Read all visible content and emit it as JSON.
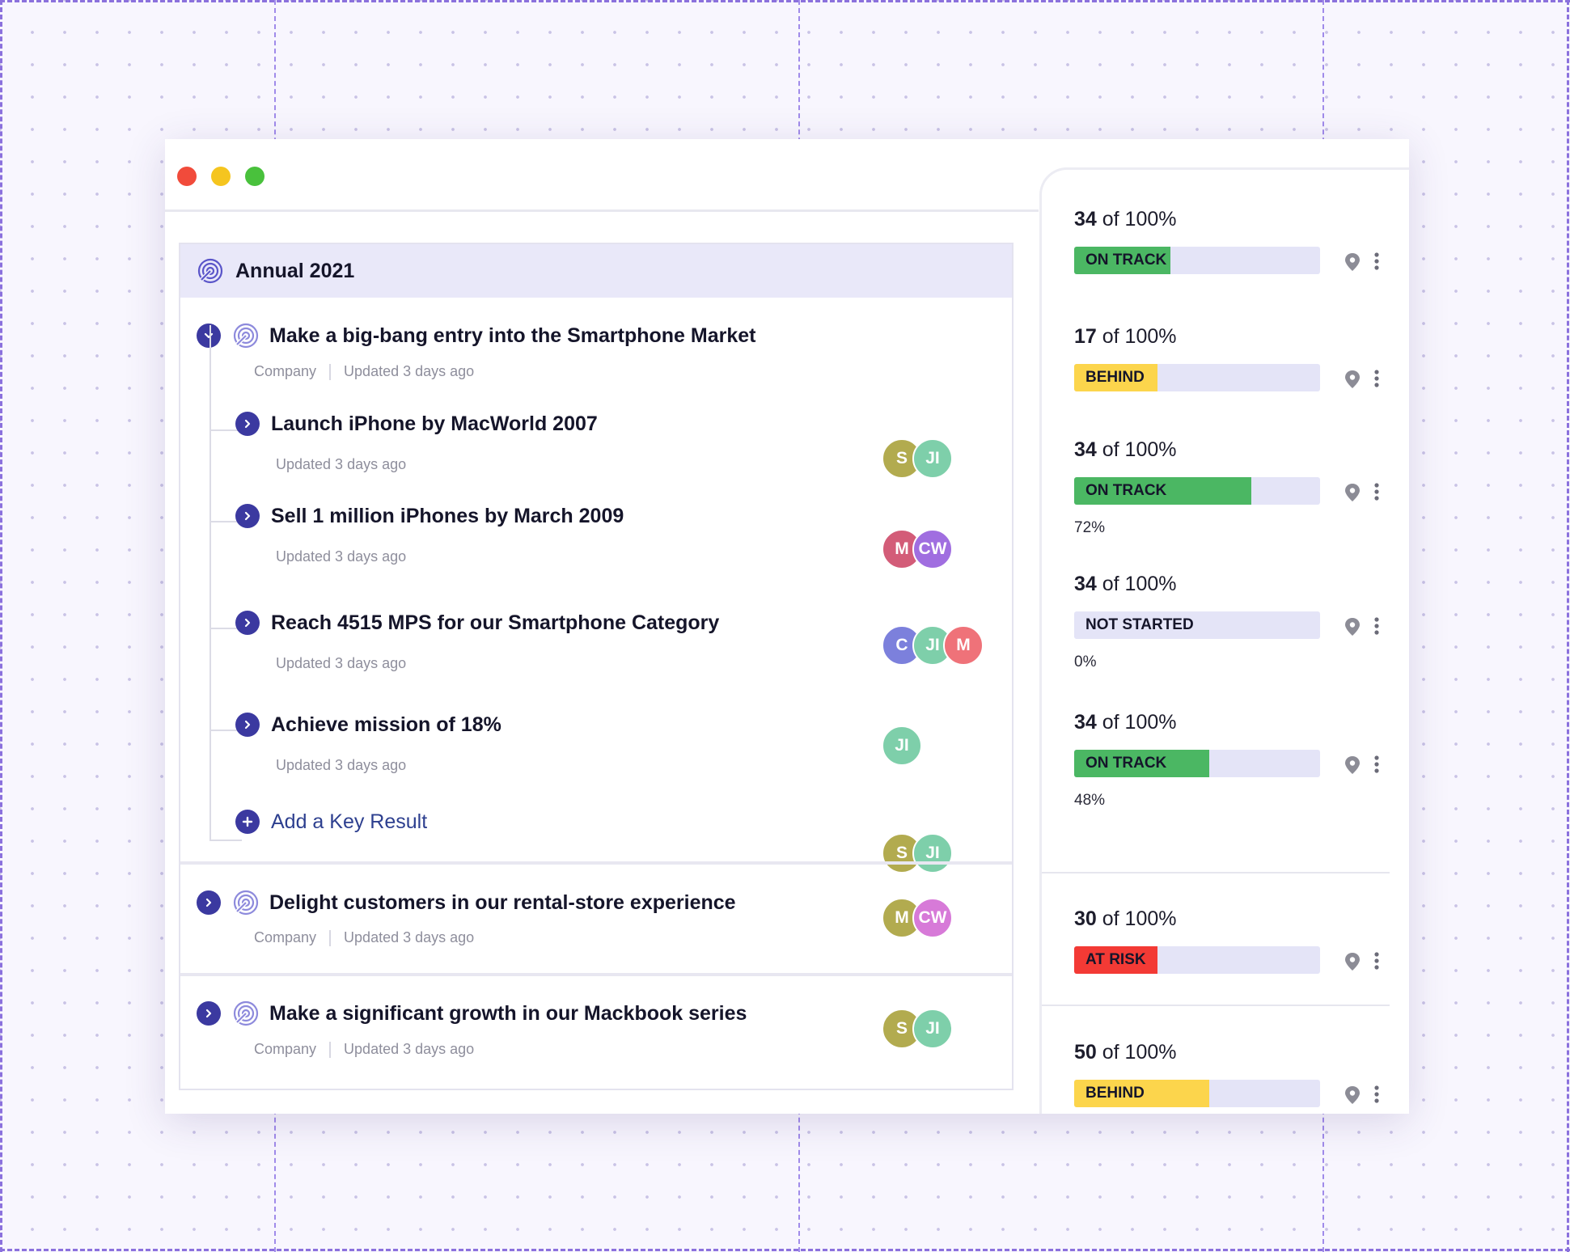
{
  "colors": {
    "on_track": "#4bb763",
    "behind": "#fcd54c",
    "at_risk": "#f33a35",
    "not_started": "#e4e4f7",
    "accent": "#3b39a0"
  },
  "period": {
    "title": "Annual 2021",
    "icon": "target-icon"
  },
  "objectives": [
    {
      "title": "Make a big-bang entry into the Smartphone Market",
      "tag": "Company",
      "updated": "Updated 3 days ago",
      "avatars": [
        {
          "initials": "S",
          "color": "#b2ab4f"
        },
        {
          "initials": "JI",
          "color": "#7ecfaa"
        }
      ],
      "key_results": [
        {
          "title": "Launch iPhone by MacWorld 2007",
          "updated": "Updated 3 days ago",
          "avatars": [
            {
              "initials": "M",
              "color": "#d35c78"
            },
            {
              "initials": "CW",
              "color": "#a06ee0"
            }
          ]
        },
        {
          "title": "Sell 1 million iPhones by March 2009",
          "updated": "Updated 3 days ago",
          "avatars": [
            {
              "initials": "C",
              "color": "#7c80dc"
            },
            {
              "initials": "JI",
              "color": "#7ecfaa"
            },
            {
              "initials": "M",
              "color": "#ef7279"
            }
          ]
        },
        {
          "title": "Reach 4515 MPS for our Smartphone Category",
          "updated": "Updated 3 days ago",
          "avatars": [
            {
              "initials": "JI",
              "color": "#7ecfaa"
            }
          ]
        },
        {
          "title": "Achieve mission of 18%",
          "updated": "Updated 3 days ago",
          "avatars": [
            {
              "initials": "S",
              "color": "#b2ab4f"
            },
            {
              "initials": "JI",
              "color": "#7ecfaa"
            }
          ]
        }
      ],
      "add_key_result_label": "Add a Key Result"
    },
    {
      "title": "Delight customers in our rental-store experience",
      "tag": "Company",
      "updated": "Updated 3 days ago",
      "avatars": [
        {
          "initials": "M",
          "color": "#b2ab4f"
        },
        {
          "initials": "CW",
          "color": "#d77ad8"
        }
      ]
    },
    {
      "title": "Make a significant growth in our Mackbook series",
      "tag": "Company",
      "updated": "Updated 3 days ago",
      "avatars": [
        {
          "initials": "S",
          "color": "#b2ab4f"
        },
        {
          "initials": "JI",
          "color": "#7ecfaa"
        }
      ]
    }
  ],
  "progress": [
    {
      "value": "34",
      "suffix": "of 100%",
      "status": "ON TRACK",
      "color": "#4bb763",
      "fill_fraction": 0.39,
      "percent_label": ""
    },
    {
      "value": "17",
      "suffix": "of 100%",
      "status": "BEHIND",
      "color": "#fcd54c",
      "fill_fraction": 0.34,
      "percent_label": ""
    },
    {
      "value": "34",
      "suffix": "of 100%",
      "status": "ON TRACK",
      "color": "#4bb763",
      "fill_fraction": 0.72,
      "percent_label": "72%"
    },
    {
      "value": "34",
      "suffix": "of 100%",
      "status": "NOT STARTED",
      "color": "#e4e4f7",
      "fill_fraction": 0,
      "percent_label": "0%"
    },
    {
      "value": "34",
      "suffix": "of 100%",
      "status": "ON TRACK",
      "color": "#4bb763",
      "fill_fraction": 0.55,
      "percent_label": "48%"
    },
    {
      "value": "30",
      "suffix": "of 100%",
      "status": "AT RISK",
      "color": "#f33a35",
      "fill_fraction": 0.34,
      "percent_label": ""
    },
    {
      "value": "50",
      "suffix": "of 100%",
      "status": "BEHIND",
      "color": "#fcd54c",
      "fill_fraction": 0.55,
      "percent_label": ""
    }
  ]
}
